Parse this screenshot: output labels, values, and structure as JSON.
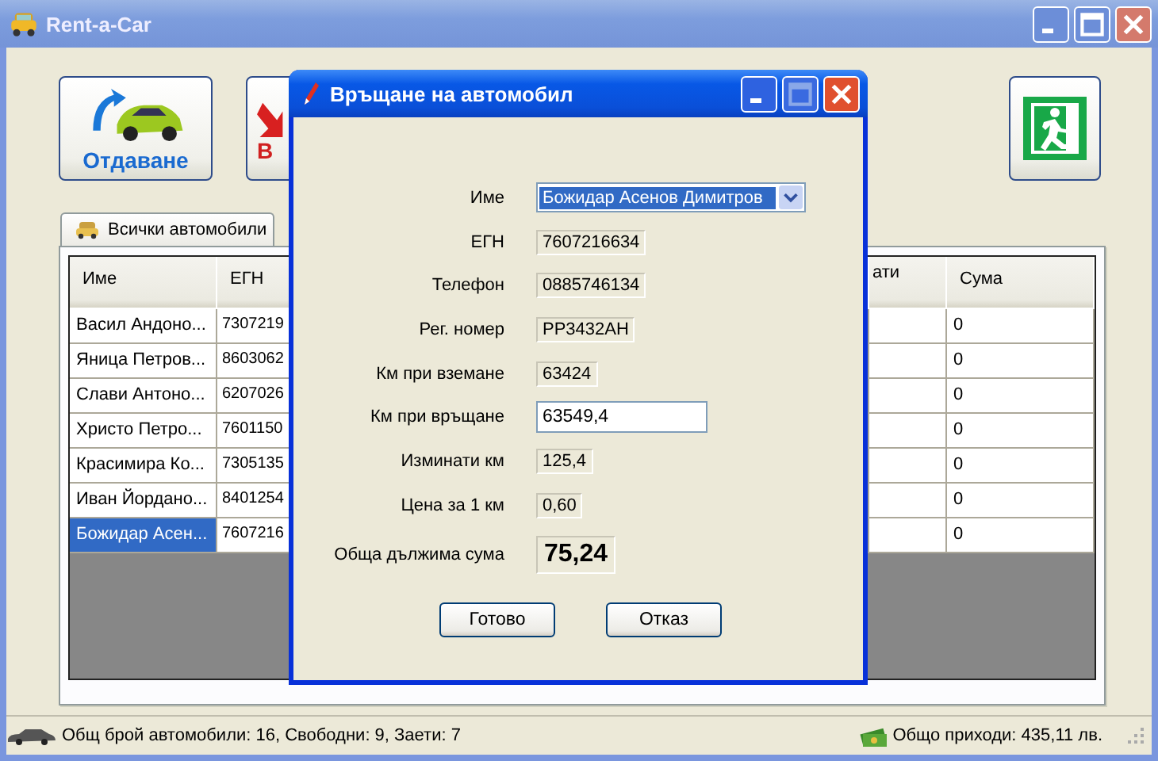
{
  "window": {
    "title": "Rent-a-Car"
  },
  "toolbar": [
    {
      "kind": "give",
      "label": "Отдаване"
    },
    {
      "kind": "return",
      "label": "В"
    },
    {
      "kind": "exit"
    }
  ],
  "tabs": [
    {
      "label": "Всички автомобили",
      "selected": false
    }
  ],
  "table": {
    "columns": [
      "Име",
      "ЕГН",
      "ати",
      "Сума"
    ],
    "rows": [
      {
        "name": "Васил Андоно...",
        "egn": "7307219",
        "sum": "0",
        "selected": false
      },
      {
        "name": "Яница Петров...",
        "egn": "8603062",
        "sum": "0",
        "selected": false
      },
      {
        "name": "Слави Антоно...",
        "egn": "6207026",
        "sum": "0",
        "selected": false
      },
      {
        "name": "Христо Петро...",
        "egn": "7601150",
        "sum": "0",
        "selected": false
      },
      {
        "name": "Красимира Ко...",
        "egn": "7305135",
        "sum": "0",
        "selected": false
      },
      {
        "name": "Иван Йордано...",
        "egn": "8401254",
        "sum": "0",
        "selected": false
      },
      {
        "name": "Божидар Асен...",
        "egn": "7607216",
        "sum": "0",
        "selected": true
      }
    ]
  },
  "dialog": {
    "title": "Връщане на автомобил",
    "fields": [
      {
        "kind": "combo",
        "label": "Име",
        "value": "Божидар Асенов Димитров"
      },
      {
        "kind": "readonly",
        "label": "ЕГН",
        "value": "7607216634"
      },
      {
        "kind": "readonly",
        "label": "Телефон",
        "value": "0885746134"
      },
      {
        "kind": "readonly",
        "label": "Рег. номер",
        "value": "PP3432AH"
      },
      {
        "kind": "readonly",
        "label": "Км при вземане",
        "value": "63424"
      },
      {
        "kind": "input",
        "label": "Км при връщане",
        "value": "63549,4"
      },
      {
        "kind": "readonly",
        "label": "Изминати км",
        "value": "125,4"
      },
      {
        "kind": "readonly",
        "label": "Цена за 1 км",
        "value": "0,60"
      },
      {
        "kind": "total",
        "label": "Обща дължима сума",
        "value": "75,24"
      }
    ],
    "buttons": [
      "Готово",
      "Отказ"
    ]
  },
  "status_bar": {
    "left": "Общ брой автомобили: 16, Свободни: 9, Заети: 7",
    "right": "Общо приходи: 435,11 лв."
  }
}
